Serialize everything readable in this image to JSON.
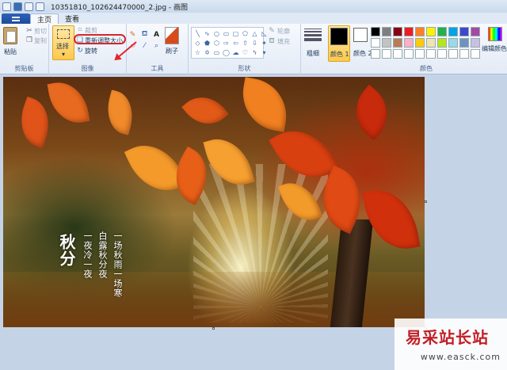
{
  "window": {
    "title": "10351810_102624470000_2.jpg - 画图"
  },
  "tabs": [
    {
      "label": "主页",
      "active": true
    },
    {
      "label": "查看",
      "active": false
    }
  ],
  "ribbon": {
    "clipboard": {
      "paste_label": "粘贴",
      "cut_label": "剪切",
      "copy_label": "复制",
      "group_label": "剪贴板"
    },
    "image": {
      "select_label": "选择",
      "crop_label": "裁剪",
      "resize_label": "重新调整大小",
      "rotate_label": "旋转",
      "group_label": "图像"
    },
    "tools": {
      "group_label": "工具",
      "brushes_label": "刷子"
    },
    "shapes": {
      "outline_label": "轮廓",
      "fill_label": "填充",
      "group_label": "形状"
    },
    "size": {
      "label": "粗细"
    },
    "colors": {
      "color1_label": "颜色 1",
      "color2_label": "颜色 2",
      "edit_label": "编辑颜色",
      "group_label": "颜色",
      "color1": "#000000",
      "color2": "#ffffff",
      "palette": [
        "#000000",
        "#7f7f7f",
        "#880015",
        "#ed1c24",
        "#ff7f27",
        "#fff200",
        "#22b14c",
        "#00a2e8",
        "#3f48cc",
        "#a349a4",
        "#ffffff",
        "#c3c3c3",
        "#b97a57",
        "#ffaec9",
        "#ffc90e",
        "#efe4b0",
        "#b5e61d",
        "#99d9ea",
        "#7092be",
        "#c8bfe7",
        "#ffffff",
        "#ffffff",
        "#ffffff",
        "#ffffff",
        "#ffffff",
        "#ffffff",
        "#ffffff",
        "#ffffff",
        "#ffffff",
        "#ffffff"
      ]
    }
  },
  "canvas": {
    "title_text": "秋分",
    "poem_lines": [
      "一场秋雨一场寒",
      "白露秋分夜",
      "一夜冷一夜"
    ]
  },
  "watermark": {
    "title": "易采站长站",
    "url": "www.easck.com"
  }
}
